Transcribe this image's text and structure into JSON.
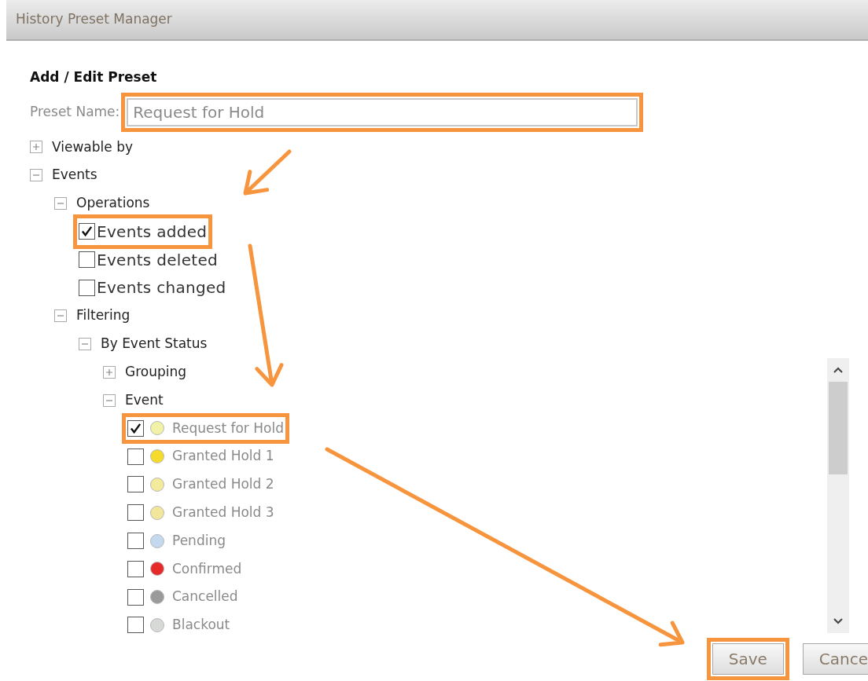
{
  "window": {
    "title": "History Preset Manager"
  },
  "form": {
    "heading": "Add / Edit Preset",
    "preset_name": {
      "label": "Preset Name:",
      "value": "Request for Hold",
      "highlighted": true
    }
  },
  "tree": [
    {
      "kind": "group",
      "label": "Viewable by",
      "expanded": false
    },
    {
      "kind": "group",
      "label": "Events",
      "expanded": true,
      "children": [
        {
          "kind": "group",
          "label": "Operations",
          "expanded": true,
          "children": [
            {
              "kind": "option",
              "label": "Events added",
              "checked": true,
              "highlighted": true
            },
            {
              "kind": "option",
              "label": "Events deleted",
              "checked": false,
              "highlighted": false
            },
            {
              "kind": "option",
              "label": "Events changed",
              "checked": false,
              "highlighted": false
            }
          ]
        },
        {
          "kind": "group",
          "label": "Filtering",
          "expanded": true,
          "children": [
            {
              "kind": "group",
              "label": "By Event Status",
              "expanded": true,
              "children": [
                {
                  "kind": "group",
                  "label": "Grouping",
                  "expanded": false
                },
                {
                  "kind": "group",
                  "label": "Event",
                  "expanded": true,
                  "children": [
                    {
                      "kind": "status",
                      "label": "Request for Hold",
                      "checked": true,
                      "highlighted": true,
                      "color": "#f2f2a6"
                    },
                    {
                      "kind": "status",
                      "label": "Granted Hold 1",
                      "checked": false,
                      "highlighted": false,
                      "color": "#f5dc2c"
                    },
                    {
                      "kind": "status",
                      "label": "Granted Hold 2",
                      "checked": false,
                      "highlighted": false,
                      "color": "#f4ea9c"
                    },
                    {
                      "kind": "status",
                      "label": "Granted Hold 3",
                      "checked": false,
                      "highlighted": false,
                      "color": "#f2e69a"
                    },
                    {
                      "kind": "status",
                      "label": "Pending",
                      "checked": false,
                      "highlighted": false,
                      "color": "#c4d9ee"
                    },
                    {
                      "kind": "status",
                      "label": "Confirmed",
                      "checked": false,
                      "highlighted": false,
                      "color": "#e62a2a"
                    },
                    {
                      "kind": "status",
                      "label": "Cancelled",
                      "checked": false,
                      "highlighted": false,
                      "color": "#9a9a9a"
                    },
                    {
                      "kind": "status",
                      "label": "Blackout",
                      "checked": false,
                      "highlighted": false,
                      "color": "#d6d9d6"
                    }
                  ]
                }
              ]
            }
          ]
        }
      ]
    }
  ],
  "buttons": [
    {
      "label": "Save",
      "highlighted": true
    },
    {
      "label": "Cance",
      "highlighted": false
    }
  ]
}
